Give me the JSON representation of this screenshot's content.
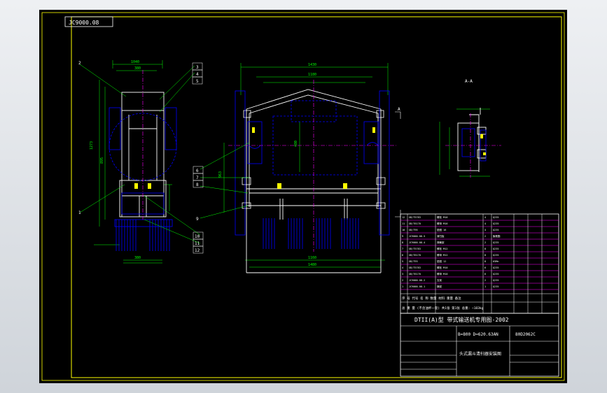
{
  "drawing_code": "JC9000.08",
  "section_label": "A-A",
  "section_marks": [
    "A",
    "A"
  ],
  "callouts_left": [
    "2",
    "3",
    "4",
    "5",
    "1"
  ],
  "callouts_front_right": [
    "6",
    "7",
    "8",
    "9"
  ],
  "callouts_bottom": [
    "10",
    "11",
    "12"
  ],
  "title_block": {
    "series_title": "DTII(A)型 带式输送机专用图-2002",
    "spec": "B=800 D=620.63AN",
    "drawing_no": "80D2062C",
    "drawing_name": "头式漏斗清扫器安装图",
    "header_row": "序 号    代号    名 称    数量    材料    重量    备注",
    "weight_row": "总  重  量 (不含油杯一套)    共1张 第1张  总重: ~183kg"
  },
  "colors": {
    "background": "#000000",
    "border": "#ffff00",
    "geometry": "#ffffff",
    "dimension": "#00ff00",
    "center": "#ff00ff",
    "hidden": "#0000ff",
    "table": "#ff00ff"
  }
}
